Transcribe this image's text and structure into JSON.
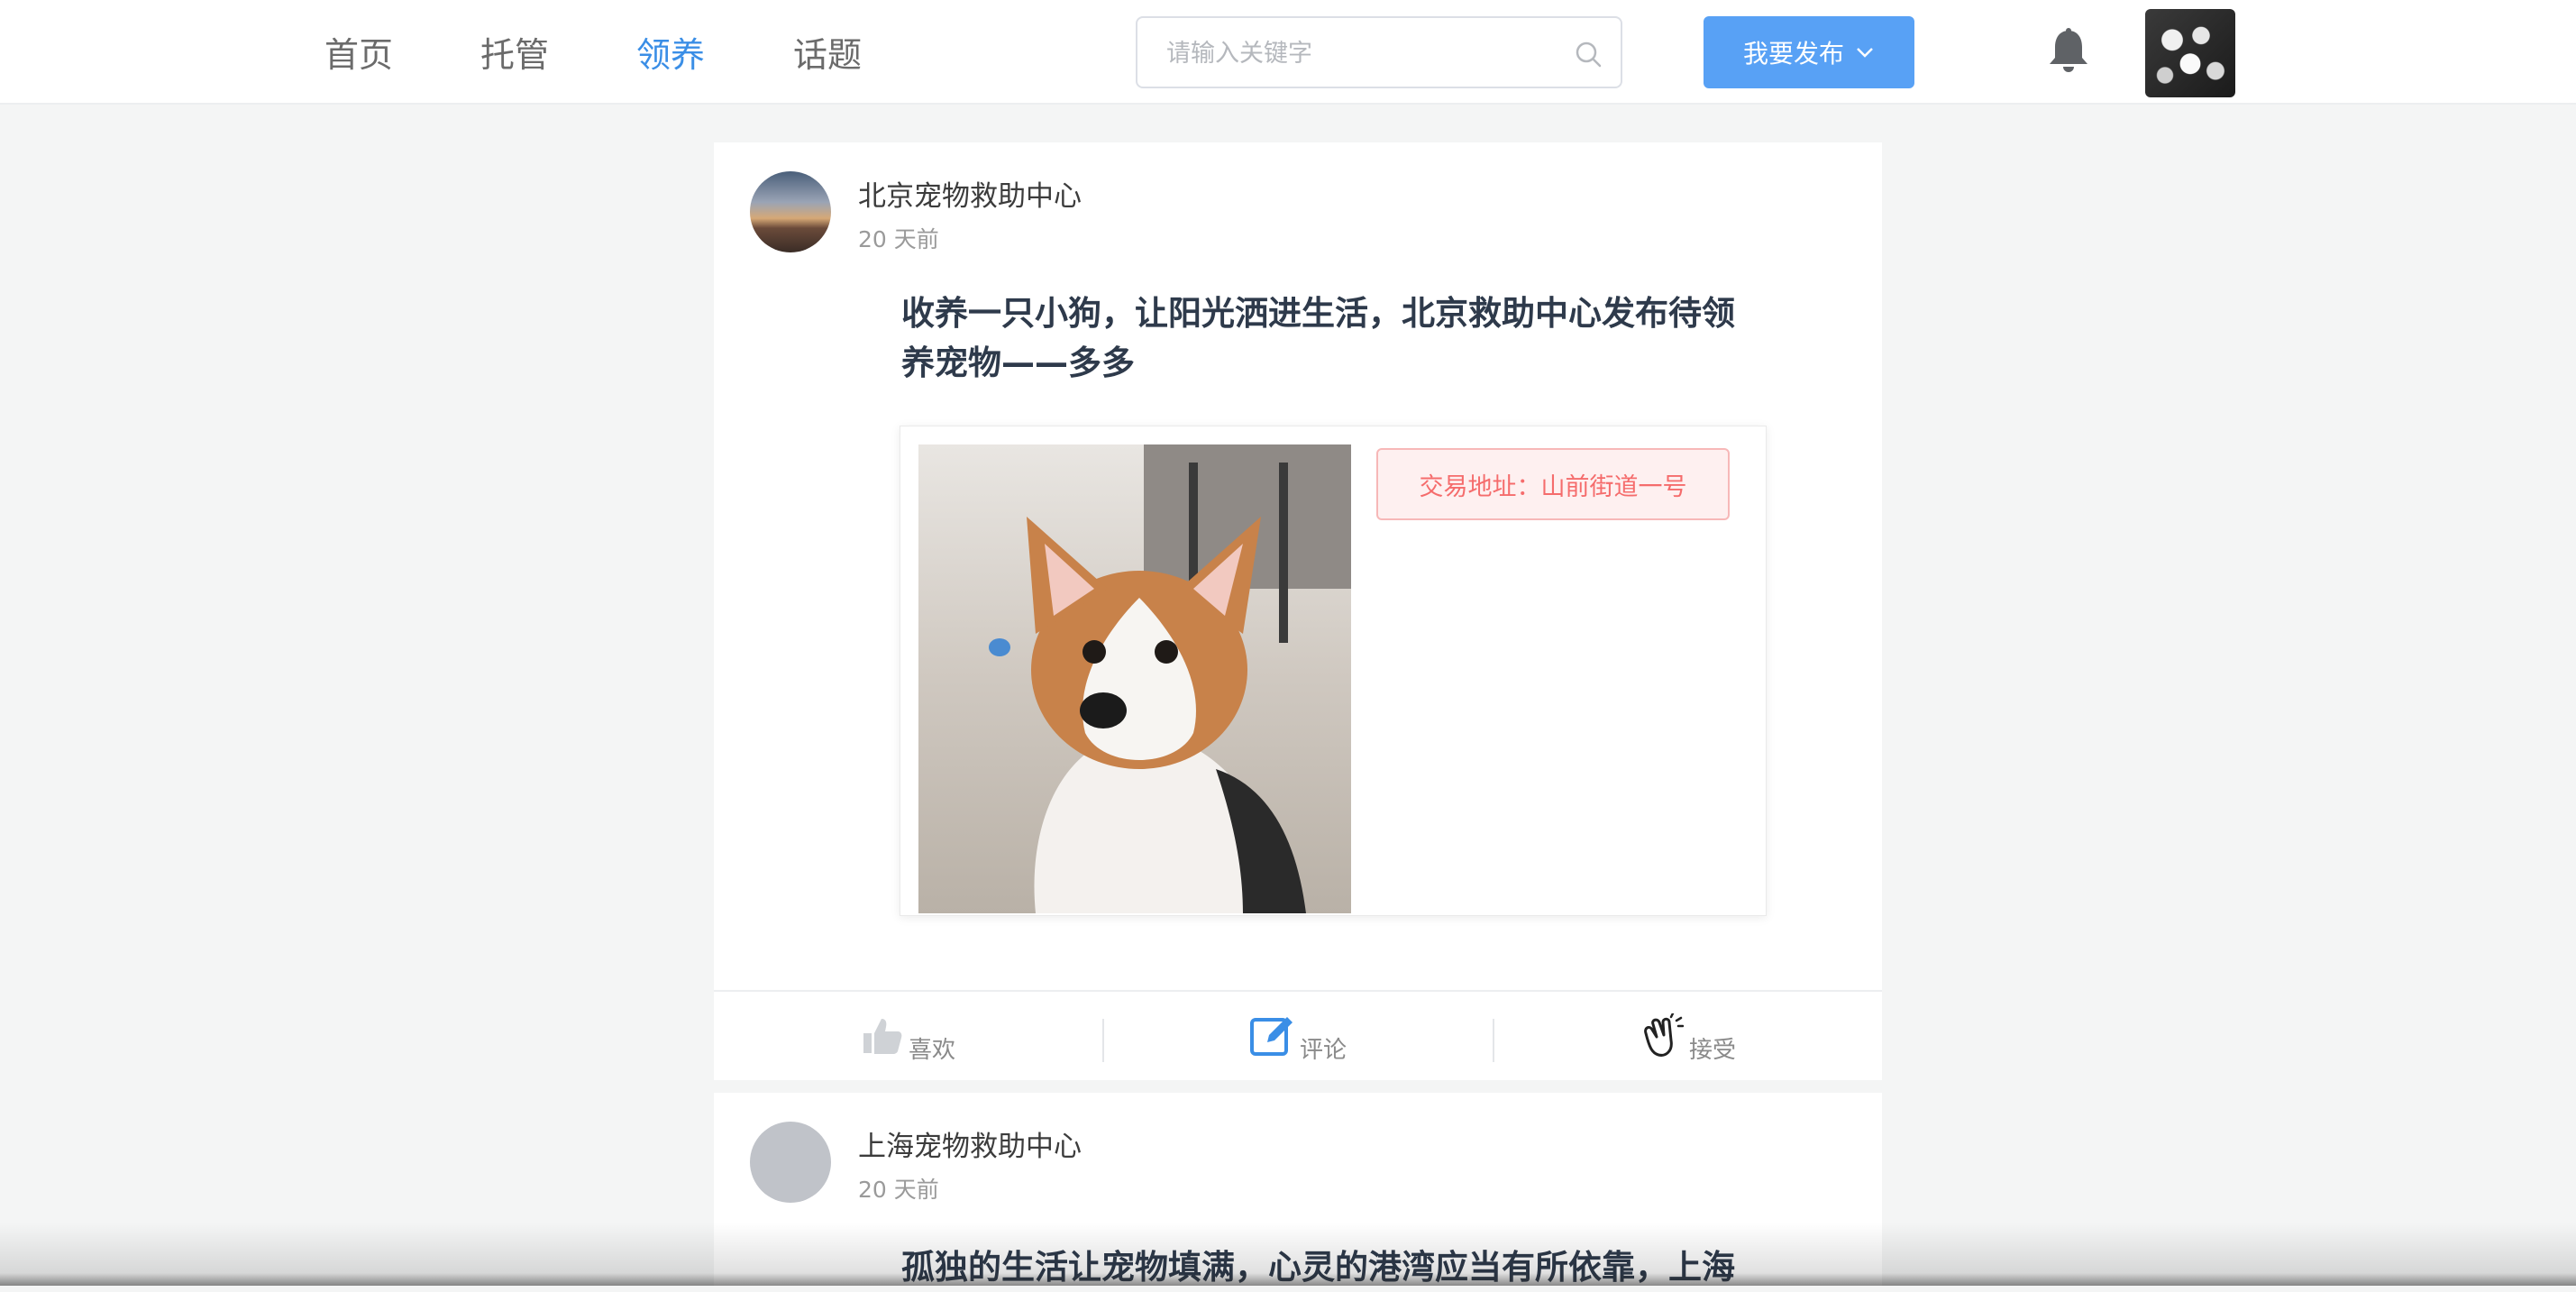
{
  "nav": {
    "items": [
      {
        "label": "首页",
        "active": false
      },
      {
        "label": "托管",
        "active": false
      },
      {
        "label": "领养",
        "active": true
      },
      {
        "label": "话题",
        "active": false
      }
    ]
  },
  "search": {
    "placeholder": "请输入关键字",
    "value": ""
  },
  "publish_button": {
    "label": "我要发布"
  },
  "colors": {
    "accent": "#58a1f5",
    "active_nav": "#3a8ee6",
    "tag_text": "#f56c6c",
    "tag_bg": "#fef0f0"
  },
  "icons": {
    "search": "search-icon",
    "bell": "bell-icon",
    "caret": "chevron-down-icon",
    "like": "thumbs-up-icon",
    "comment": "edit-icon",
    "accept": "clap-hands-icon"
  },
  "posts": [
    {
      "org": "北京宠物救助中心",
      "time": "20 天前",
      "title": "收养一只小狗，让阳光洒进生活，北京救助中心发布待领养宠物——多多",
      "address_tag": "交易地址：山前街道一号",
      "actions": {
        "like": "喜欢",
        "comment": "评论",
        "accept": "接受"
      }
    },
    {
      "org": "上海宠物救助中心",
      "time": "20 天前",
      "title": "孤独的生活让宠物填满，心灵的港湾应当有所依靠，上海"
    }
  ]
}
